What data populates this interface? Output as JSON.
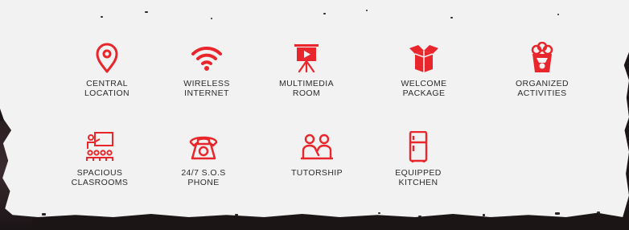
{
  "theme": {
    "accent": "#e8262b",
    "text": "#2b2b2b",
    "paper": "#f2f2f2"
  },
  "amenities": [
    {
      "icon": "location-pin-icon",
      "label": "CENTRAL\nLOCATION"
    },
    {
      "icon": "wifi-icon",
      "label": "WIRELESS\nINTERNET"
    },
    {
      "icon": "projector-screen-icon",
      "label": "MULTIMEDIA\nROOM"
    },
    {
      "icon": "gift-box-icon",
      "label": "WELCOME\nPACKAGE"
    },
    {
      "icon": "popcorn-icon",
      "label": "ORGANIZED\nACTIVITIES"
    },
    {
      "icon": "classroom-icon",
      "label": "SPACIOUS\nCLASROOMS"
    },
    {
      "icon": "telephone-icon",
      "label": "24/7 S.O.S\nPHONE"
    },
    {
      "icon": "tutoring-icon",
      "label": "TUTORSHIP"
    },
    {
      "icon": "refrigerator-icon",
      "label": "EQUIPPED\nKITCHEN"
    }
  ]
}
